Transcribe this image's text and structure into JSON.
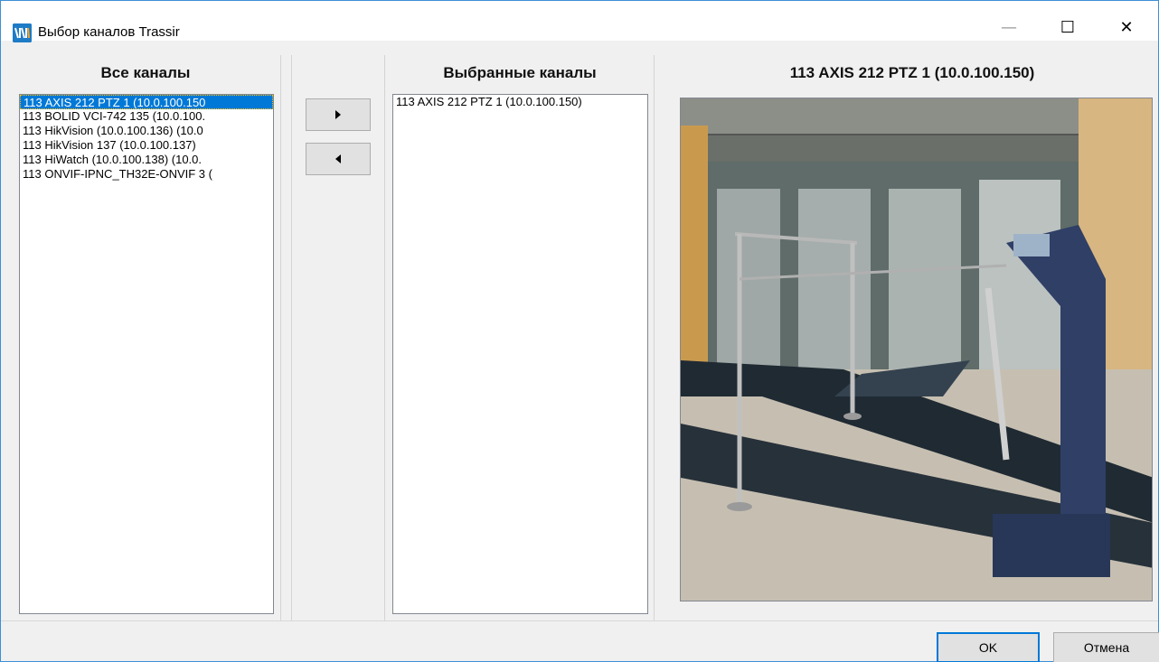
{
  "window": {
    "title": "Выбор каналов Trassir",
    "minimize_glyph": "—",
    "maximize_glyph": "☐",
    "close_glyph": "✕"
  },
  "all_channels": {
    "header": "Все каналы",
    "items": [
      "113 AXIS 212 PTZ 1 (10.0.100.150",
      "113 BOLID VCI-742 135 (10.0.100.",
      "113 HikVision (10.0.100.136) (10.0",
      "113 HikVision 137 (10.0.100.137)",
      "113 HiWatch (10.0.100.138) (10.0.",
      "113 ONVIF-IPNC_TH32E-ONVIF 3 ("
    ],
    "selected_index": 0
  },
  "selected_channels": {
    "header": "Выбранные каналы",
    "items": [
      "113 AXIS 212 PTZ 1 (10.0.100.150)"
    ]
  },
  "move_buttons": {
    "add_icon": "arrow-right-icon",
    "remove_icon": "arrow-left-icon"
  },
  "preview": {
    "title": "113 AXIS 212 PTZ 1 (10.0.100.150)"
  },
  "buttons": {
    "ok": "OK",
    "cancel": "Отмена"
  },
  "colors": {
    "selection": "#0078d7",
    "turnstile": "#2f3f66",
    "accent_border": "#3c8fd6"
  }
}
